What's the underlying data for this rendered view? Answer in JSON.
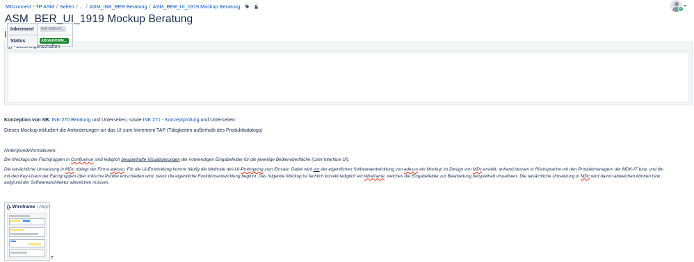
{
  "breadcrumb": {
    "items": [
      "MDconnect - TP ASM",
      "Seiten",
      "...",
      "ASM_INK_BER Beratung",
      "ASM_BER_UI_1919 Mockup Beratung"
    ]
  },
  "page": {
    "title": "ASM_BER_UI_1919 Mockup Beratung"
  },
  "properties": {
    "header": "Seiteneigenschaften",
    "rows": [
      {
        "label": "Inkrement",
        "value": "INK-BERAT..."
      },
      {
        "label": "Status",
        "value": "ABGENOMM..."
      }
    ]
  },
  "content": {
    "konzeption_label": "Konzeption von SB:",
    "konzeption_link1": "INK-270 Beratung",
    "konzeption_mid": "und Unterseiten, sowie",
    "konzeption_link2": "INK 271 - Konzeptprüfung",
    "konzeption_end": "und Unterseiten",
    "mockup_note": "Dieses Mockup inkludiert die Anforderungen an das UI zum Inkrement TAP (Tätigkeiten außerhalb des Produktkatalogs)",
    "hintergrund": "Hintergrundinformationen:",
    "p1_a": "Die Mockups der Fachgruppen in",
    "p1_b": "Confluence",
    "p1_c": "sind lediglich",
    "p1_d": "beispielhafte Visualisierungen",
    "p1_e": "der notwendigen Eingabefelder für die jeweilige Bedienoberfläche (User Interface UI).",
    "p2_a": "Die tatsächliche Umsetzung in",
    "p2_b": "MDc",
    "p2_c": "obliegt der Firma",
    "p2_d": "adesso",
    "p2_e": ". Für die UI-Entwicklung kommt häufig die Methode des UI-",
    "p2_f": "Prototyping",
    "p2_g": "zum Einsatz. Dabei wird",
    "p2_h": "vor",
    "p2_i": "der eigentlichen Softwareentwicklung von",
    "p2_j": "adesso",
    "p2_k": "ein Mockup im Design von",
    "p2_l": "MDc",
    "p2_m": "erstellt, anhand dessen in Rücksprache mit den Produktmanagern der MDK-IT bzw. und tlw.",
    "p3_a": "mit den Key-Usern der Fachgruppen über kritische Punkte entschieden wird, bevor die eigentliche Funktionsentwicklung beginnt. Das folgende Mockup ist fachlich korrekt lediglich ein",
    "p3_b": "Wireframe",
    "p3_c": ", welches die Eingabefelder zur Bearbeitung beispielhaft visualisiert. Die tatsächliche Umsetzung in",
    "p3_d": "MDc",
    "p3_e": "wird davon abweichen können bzw.",
    "p4": "aufgrund der Softwarearchitektur abweichen müssen."
  },
  "wireframe": {
    "title": "Wireframe",
    "subtitle": "| Align",
    "trailing": "e"
  },
  "colors": {
    "link": "#0052cc",
    "status_green": "#14892c",
    "text": "#172b4d"
  },
  "icons": [
    "tag-icon",
    "restriction-icon",
    "user-avatar-icon",
    "wireframe-logo-icon",
    "page-properties-icon"
  ]
}
